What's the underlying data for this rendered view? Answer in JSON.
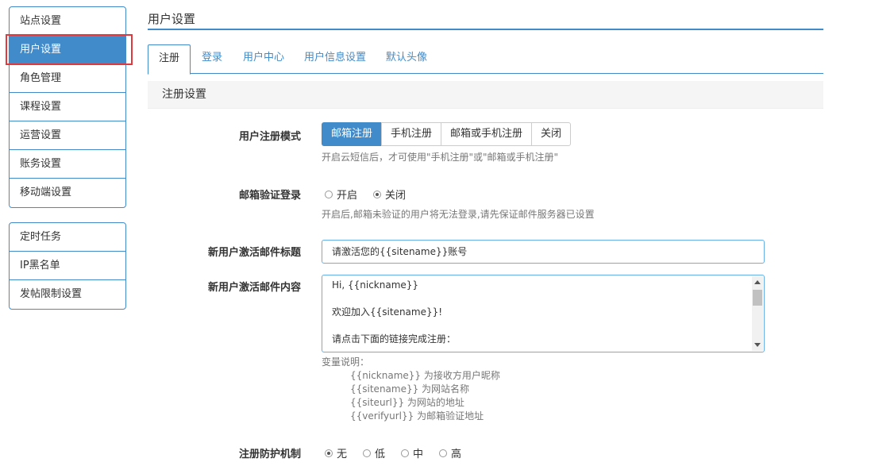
{
  "sidebar": {
    "group1": [
      {
        "label": "站点设置"
      },
      {
        "label": "用户设置",
        "active": true
      },
      {
        "label": "角色管理"
      },
      {
        "label": "课程设置"
      },
      {
        "label": "运营设置"
      },
      {
        "label": "账务设置"
      },
      {
        "label": "移动端设置"
      }
    ],
    "group2": [
      {
        "label": "定时任务"
      },
      {
        "label": "IP黑名单"
      },
      {
        "label": "发帖限制设置"
      }
    ]
  },
  "page": {
    "title": "用户设置"
  },
  "tabs": [
    {
      "label": "注册",
      "active": true
    },
    {
      "label": "登录"
    },
    {
      "label": "用户中心"
    },
    {
      "label": "用户信息设置"
    },
    {
      "label": "默认头像"
    }
  ],
  "section": {
    "title": "注册设置"
  },
  "form": {
    "register_mode": {
      "label": "用户注册模式",
      "options": [
        "邮箱注册",
        "手机注册",
        "邮箱或手机注册",
        "关闭"
      ],
      "selected": "邮箱注册",
      "help": "开启云短信后，才可使用\"手机注册\"或\"邮箱或手机注册\""
    },
    "email_verify": {
      "label": "邮箱验证登录",
      "options": [
        "开启",
        "关闭"
      ],
      "selected": "关闭",
      "help": "开启后,邮箱未验证的用户将无法登录,请先保证邮件服务器已设置"
    },
    "activation_subject": {
      "label": "新用户激活邮件标题",
      "value": "请激活您的{{sitename}}账号"
    },
    "activation_body": {
      "label": "新用户激活邮件内容",
      "lines": [
        "Hi, {{nickname}}",
        "",
        "欢迎加入{{sitename}}!",
        "",
        "请点击下面的链接完成注册："
      ]
    },
    "variables": {
      "title": "变量说明：",
      "items": [
        "{{nickname}} 为接收方用户昵称",
        "{{sitename}} 为网站名称",
        "{{siteurl}} 为网站的地址",
        "{{verifyurl}} 为邮箱验证地址"
      ]
    },
    "protection": {
      "label": "注册防护机制",
      "options": [
        "无",
        "低",
        "中",
        "高"
      ],
      "selected": "无"
    }
  }
}
